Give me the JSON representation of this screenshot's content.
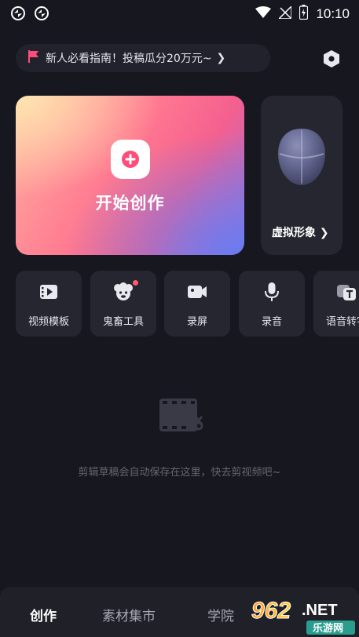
{
  "status_bar": {
    "time": "10:10",
    "left_icons": [
      "sync-icon",
      "sync-icon"
    ],
    "right_icons": [
      "wifi-icon",
      "signal-off-icon",
      "battery-charging-icon"
    ]
  },
  "banner": {
    "text": "新人必看指南！投稿瓜分20万元~",
    "arrow": "❯",
    "flag_color": "#ff4d7a"
  },
  "create": {
    "label": "开始创作"
  },
  "avatar": {
    "label": "虚拟形象 ❯"
  },
  "tools": [
    {
      "label": "视频模板",
      "icon": "video-template-icon"
    },
    {
      "label": "鬼畜工具",
      "icon": "sheep-face-icon",
      "badge": true
    },
    {
      "label": "录屏",
      "icon": "screen-record-icon"
    },
    {
      "label": "录音",
      "icon": "microphone-icon"
    },
    {
      "label": "语音转字",
      "icon": "speech-to-text-icon"
    }
  ],
  "empty_state": {
    "text": "剪辑草稿会自动保存在这里，快去剪视频吧~"
  },
  "bottom_nav": {
    "items": [
      "创作",
      "素材集市",
      "学院"
    ],
    "active": "创作"
  },
  "watermark": {
    "text": "962.NET",
    "subtext": "乐游网"
  },
  "colors": {
    "background": "#17171f",
    "card": "#262631",
    "accent_pink": "#ff5a6e"
  }
}
